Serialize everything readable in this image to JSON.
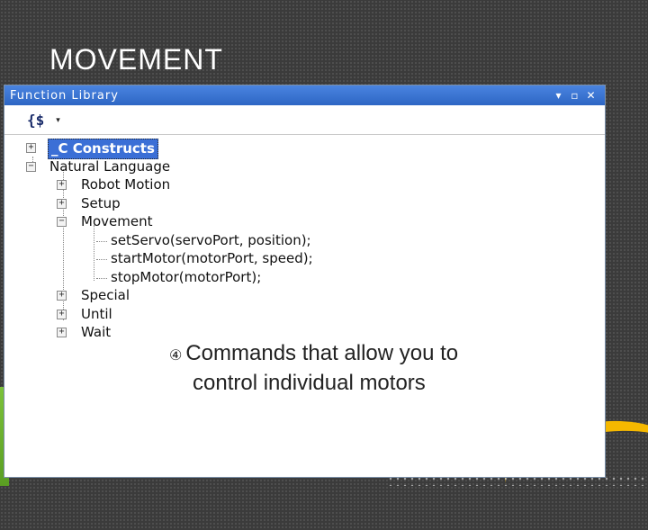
{
  "slide": {
    "title": "MOVEMENT"
  },
  "window": {
    "title": "Function Library",
    "controls": [
      "▾",
      "▫",
      "✕"
    ],
    "toolbar_icon": "{$",
    "toolbar_dropdown": "▾"
  },
  "tree": {
    "items": [
      {
        "label": "_C Constructs",
        "expander": "+",
        "selected": true
      },
      {
        "label": "Natural Language",
        "expander": "−"
      },
      {
        "label": "Robot Motion",
        "expander": "+"
      },
      {
        "label": "Setup",
        "expander": "+"
      },
      {
        "label": "Movement",
        "expander": "−"
      },
      {
        "label": "setServo(servoPort, position);"
      },
      {
        "label": "startMotor(motorPort, speed);"
      },
      {
        "label": "stopMotor(motorPort);"
      },
      {
        "label": "Special",
        "expander": "+"
      },
      {
        "label": "Until",
        "expander": "+"
      },
      {
        "label": "Wait",
        "expander": "+"
      }
    ]
  },
  "bullet": {
    "marker": "④",
    "line1": "Commands that allow you to",
    "line2": "control individual motors"
  },
  "colors": {
    "titlebar": "#2d66c4",
    "selection": "#3b6fd6",
    "accent_green": "#7cc23a",
    "accent_yellow": "#f5b800"
  }
}
